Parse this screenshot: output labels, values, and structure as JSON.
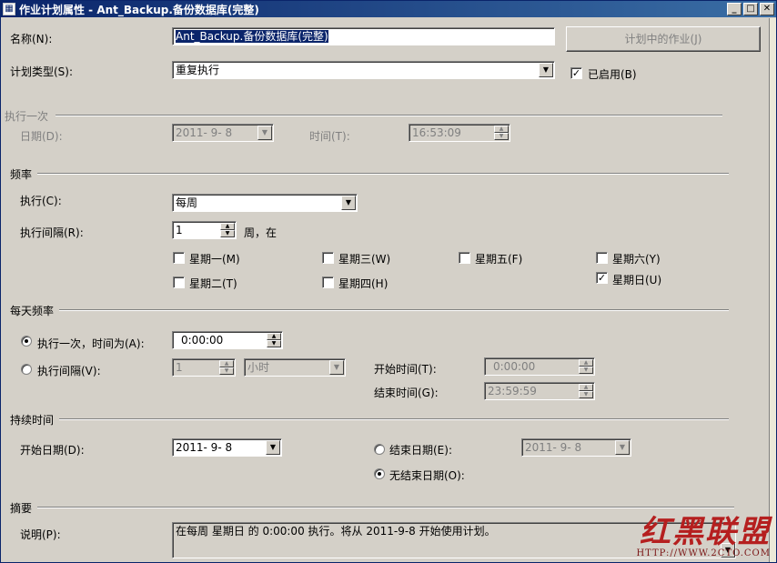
{
  "window": {
    "title": "作业计划属性 - Ant_Backup.备份数据库(完整)"
  },
  "name_field": {
    "label": "名称(N):",
    "value": "Ant_Backup.备份数据库(完整)"
  },
  "jobs_button": {
    "label": "计划中的作业(J)"
  },
  "schedule_type": {
    "label": "计划类型(S):",
    "value": "重复执行"
  },
  "enabled": {
    "label": "已启用(B)",
    "checked": true
  },
  "once_group": {
    "title": "执行一次",
    "date_label": "日期(D):",
    "date_value": "2011- 9- 8",
    "time_label": "时间(T):",
    "time_value": "16:53:09"
  },
  "frequency_group": {
    "title": "频率",
    "occurs_label": "执行(C):",
    "occurs_value": "每周",
    "recurs_label": "执行间隔(R):",
    "recurs_value": "1",
    "recurs_unit": "周，在",
    "days": [
      {
        "label": "星期一(M)",
        "checked": false
      },
      {
        "label": "星期三(W)",
        "checked": false
      },
      {
        "label": "星期五(F)",
        "checked": false
      },
      {
        "label": "星期六(Y)",
        "checked": false
      },
      {
        "label": "星期二(T)",
        "checked": false
      },
      {
        "label": "星期四(H)",
        "checked": false
      },
      {
        "label": "星期日(U)",
        "checked": true
      }
    ]
  },
  "daily_group": {
    "title": "每天频率",
    "once_label": "执行一次，时间为(A):",
    "once_value": "0:00:00",
    "every_label": "执行间隔(V):",
    "every_value": "1",
    "every_unit": "小时",
    "start_label": "开始时间(T):",
    "start_value": "0:00:00",
    "end_label": "结束时间(G):",
    "end_value": "23:59:59"
  },
  "duration_group": {
    "title": "持续时间",
    "start_date_label": "开始日期(D):",
    "start_date_value": "2011- 9- 8",
    "end_date_label": "结束日期(E):",
    "end_date_value": "2011- 9- 8",
    "no_end_label": "无结束日期(O):"
  },
  "summary_group": {
    "title": "摘要",
    "desc_label": "说明(P):",
    "desc_value": "在每周 星期日 的 0:00:00 执行。将从 2011-9-8 开始使用计划。"
  },
  "watermark": {
    "text": "红黑联盟",
    "url": "HTTP://WWW.2CTO.COM"
  },
  "colors": {
    "titlebar": "#0a246a",
    "face": "#d4d0c8",
    "watermark": "#b51f1f"
  }
}
